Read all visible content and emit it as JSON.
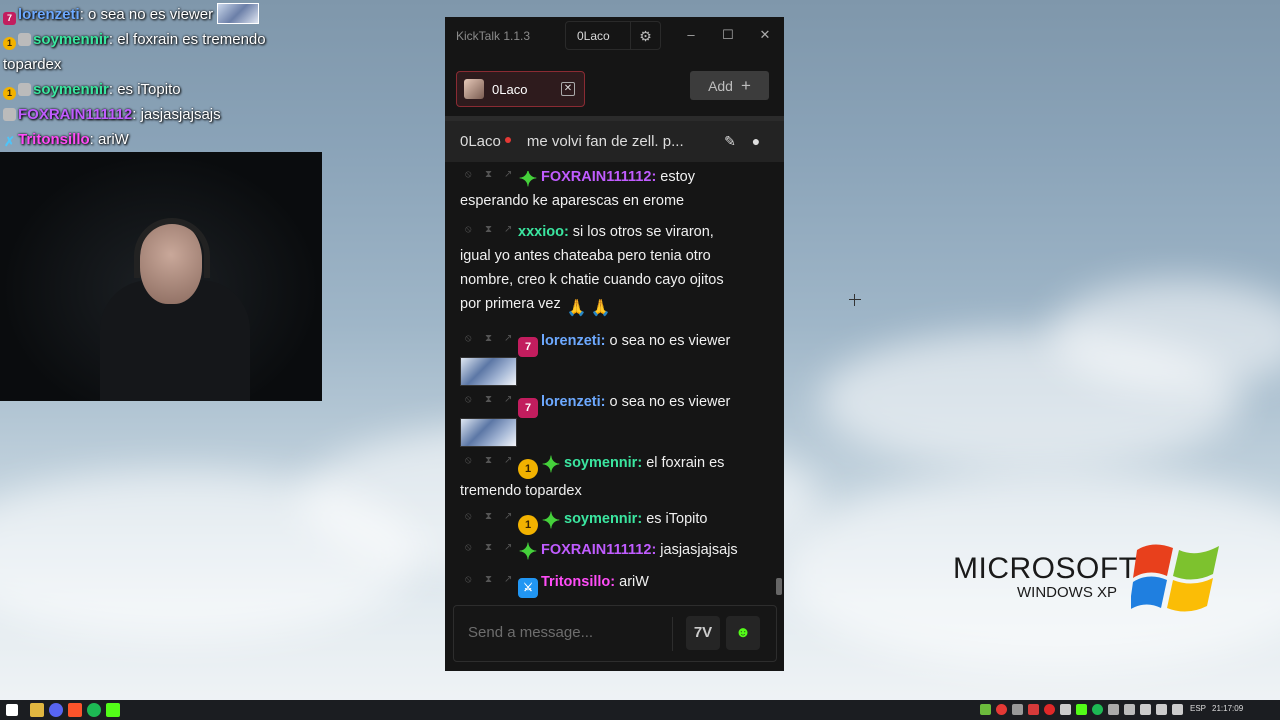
{
  "overlay_chat": [
    {
      "user": "lorenzeti",
      "color": "#6da9ff",
      "text": "o sea no es viewer",
      "badges": [
        "7tv"
      ],
      "has_thumb": true
    },
    {
      "user": "soymennir",
      "color": "#3be6a0",
      "text": "el foxrain es tremendo topardex",
      "badges": [
        "gold",
        "gem"
      ]
    },
    {
      "user": "soymennir",
      "color": "#3be6a0",
      "text": "es iTopito",
      "badges": [
        "gold",
        "gem"
      ]
    },
    {
      "user": "FOXRAIN111112",
      "color": "#c05cff",
      "text": "jasjasjajsajs",
      "badges": [
        "gem"
      ]
    },
    {
      "user": "Tritonsillo",
      "color": "#ff4df7",
      "text": "ariW",
      "badges": [
        "mod"
      ]
    }
  ],
  "app": {
    "title": "KickTalk 1.1.3",
    "current_user": "0Laco",
    "tab_label": "0Laco",
    "add_label": "Add",
    "streamer": "0Laco",
    "stream_title": "me volvi fan de zell. p...",
    "input_placeholder": "Send a message..."
  },
  "messages": [
    {
      "user": "FOXRAIN111112",
      "color": "#c05cff",
      "text": "estoy",
      "line2": "esperando ke aparescas en erome",
      "badges": [
        "gem"
      ]
    },
    {
      "user": "xxxioo",
      "color": "#3be6a0",
      "text": "si los otros se viraron,",
      "line2": "igual yo antes chateaba pero tenia otro",
      "line3": "nombre, creo k chatie cuando cayo ojitos",
      "line4": "por primera vez"
    },
    {
      "user": "lorenzeti",
      "color": "#6da9ff",
      "text": "o sea no es viewer",
      "badges": [
        "7tv"
      ],
      "has_thumb": true
    },
    {
      "user": "lorenzeti",
      "color": "#6da9ff",
      "text": "o sea no es viewer",
      "badges": [
        "7tv"
      ],
      "has_thumb": true
    },
    {
      "user": "soymennir",
      "color": "#3be6a0",
      "text": "el foxrain es",
      "line2": "tremendo topardex",
      "badges": [
        "gold",
        "gem"
      ]
    },
    {
      "user": "soymennir",
      "color": "#3be6a0",
      "text": "es iTopito",
      "badges": [
        "gold",
        "gem"
      ]
    },
    {
      "user": "FOXRAIN111112",
      "color": "#c05cff",
      "text": "jasjasjajsajs",
      "badges": [
        "gem"
      ]
    },
    {
      "user": "Tritonsillo",
      "color": "#ff4df7",
      "text": "ariW",
      "badges": [
        "mod"
      ]
    }
  ],
  "desktop": {
    "logo_word": "MICROSOFT",
    "logo_sub": "WINDOWS XP"
  },
  "taskbar": {
    "lang": "ESP",
    "time": "21:17:09"
  },
  "colors": {
    "window_bg": "#151515",
    "tab_border": "#8a2b33",
    "kick_green": "#53fc18"
  }
}
